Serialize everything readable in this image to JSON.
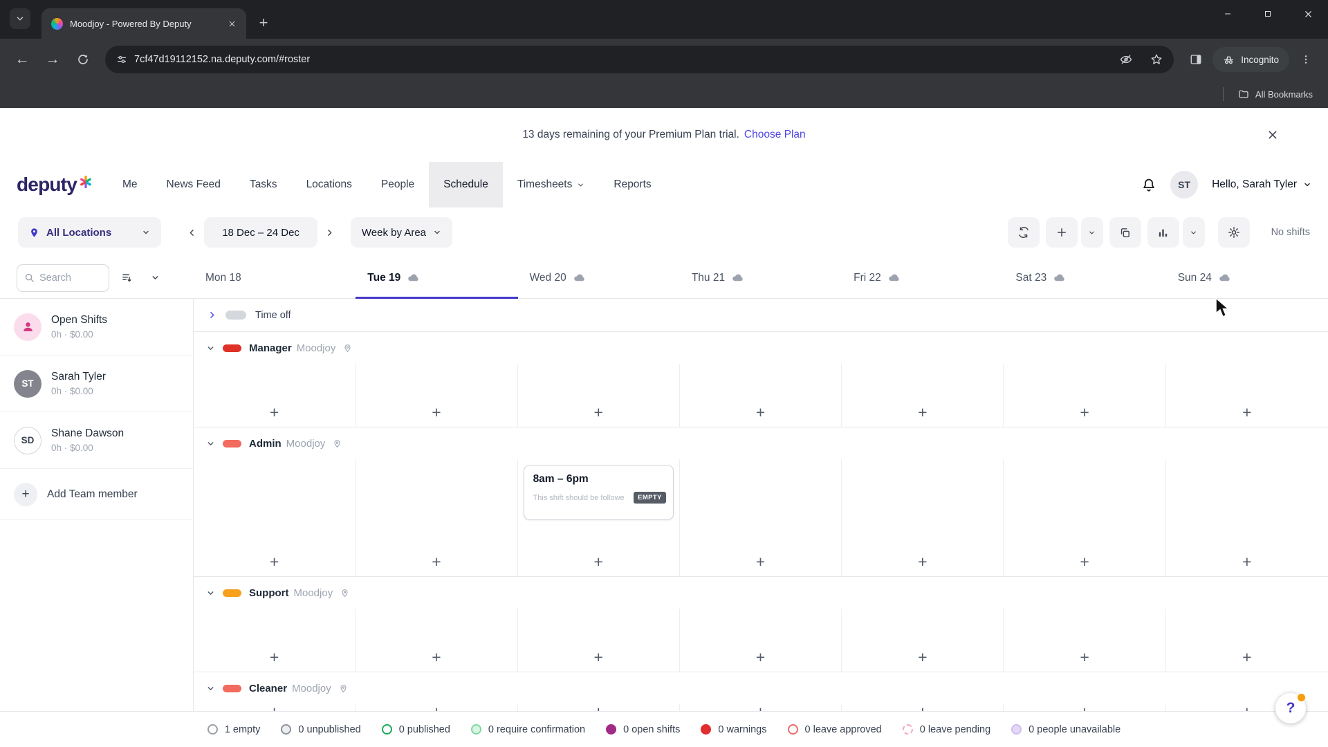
{
  "browser": {
    "tab_title": "Moodjoy - Powered By Deputy",
    "url": "7cf47d19112152.na.deputy.com/#roster",
    "incognito_label": "Incognito",
    "bookmarks_label": "All Bookmarks"
  },
  "banner": {
    "text": "13 days remaining of your Premium Plan trial.",
    "link": "Choose Plan"
  },
  "nav": {
    "logo": "deputy",
    "items": [
      {
        "label": "Me"
      },
      {
        "label": "News Feed"
      },
      {
        "label": "Tasks"
      },
      {
        "label": "Locations"
      },
      {
        "label": "People"
      },
      {
        "label": "Schedule",
        "active": true
      },
      {
        "label": "Timesheets",
        "caret": true
      },
      {
        "label": "Reports"
      }
    ],
    "greeting": "Hello, Sarah Tyler",
    "avatar_initials": "ST"
  },
  "toolbar": {
    "location_filter": "All Locations",
    "date_range": "18 Dec – 24 Dec",
    "view_mode": "Week by Area",
    "no_shifts_label": "No shifts"
  },
  "days": [
    {
      "label": "Mon 18",
      "weather": false,
      "active": false
    },
    {
      "label": "Tue 19",
      "weather": true,
      "active": true
    },
    {
      "label": "Wed 20",
      "weather": true,
      "active": false
    },
    {
      "label": "Thu 21",
      "weather": true,
      "active": false
    },
    {
      "label": "Fri 22",
      "weather": true,
      "active": false
    },
    {
      "label": "Sat 23",
      "weather": true,
      "active": false
    },
    {
      "label": "Sun 24",
      "weather": true,
      "active": false
    }
  ],
  "sidebar": {
    "search_placeholder": "Search",
    "members": [
      {
        "name": "Open Shifts",
        "stats": "0h · $0.00",
        "avatar": {
          "type": "icon",
          "bg": "#fbdcec",
          "fg": "#d6357f"
        }
      },
      {
        "name": "Sarah Tyler",
        "stats": "0h · $0.00",
        "avatar": {
          "type": "initials",
          "text": "ST",
          "bg": "#84848e",
          "fg": "#ffffff",
          "border": "none"
        }
      },
      {
        "name": "Shane Dawson",
        "stats": "0h · $0.00",
        "avatar": {
          "type": "initials",
          "text": "SD",
          "bg": "#ffffff",
          "fg": "#374151",
          "border": "#d1d5db"
        }
      }
    ],
    "add_member_label": "Add Team member"
  },
  "schedule": {
    "timeoff_label": "Time off",
    "areas": [
      {
        "name": "Manager",
        "location": "Moodjoy",
        "color": "#e03126"
      },
      {
        "name": "Admin",
        "location": "Moodjoy",
        "color": "#f26b5e",
        "card": {
          "time": "8am – 6pm",
          "note": "This shift should be followe",
          "badge": "EMPTY",
          "day": 2
        }
      },
      {
        "name": "Support",
        "location": "Moodjoy",
        "color": "#f7a01d"
      },
      {
        "name": "Cleaner",
        "location": "Moodjoy",
        "color": "#f26b5e"
      }
    ]
  },
  "legend": {
    "items": [
      {
        "label": "1 empty",
        "fill": "#ffffff",
        "border_color": "#9aa0a6",
        "border_style": "solid"
      },
      {
        "label": "0 unpublished",
        "fill": "#eceef0",
        "border_color": "#8d939b",
        "border_style": "solid"
      },
      {
        "label": "0 published",
        "fill": "#ffffff",
        "border_color": "#1faa5a",
        "border_style": "solid"
      },
      {
        "label": "0 require confirmation",
        "fill": "#d9f4e1",
        "border_color": "#7ed8a1",
        "border_style": "solid"
      },
      {
        "label": "0 open shifts",
        "fill": "#a02c86",
        "border_color": "#a02c86",
        "border_style": "solid"
      },
      {
        "label": "0 warnings",
        "fill": "#e02d2d",
        "border_color": "#e02d2d",
        "border_style": "solid"
      },
      {
        "label": "0 leave approved",
        "fill": "#ffffff",
        "border_color": "#ef6a6a",
        "border_style": "solid"
      },
      {
        "label": "0 leave pending",
        "fill": "#ffffff",
        "border_color": "#f2a7c3",
        "border_style": "dashed"
      },
      {
        "label": "0 people unavailable",
        "fill": "#e3d9f6",
        "border_color": "#cdbcf0",
        "border_style": "solid"
      }
    ]
  },
  "help": {
    "label": "?"
  }
}
